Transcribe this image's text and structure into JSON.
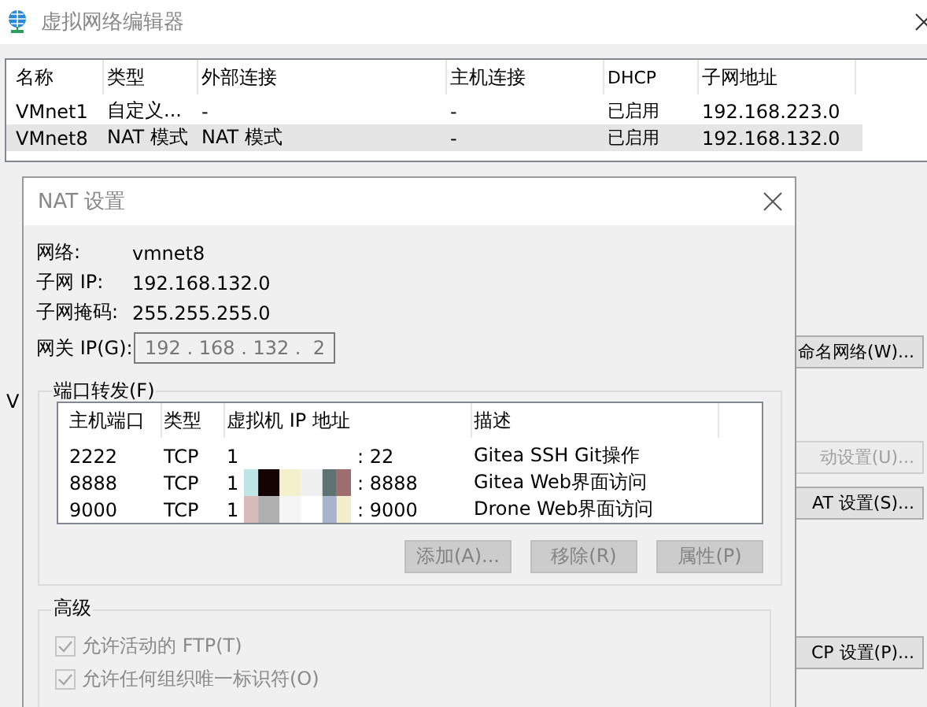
{
  "window": {
    "title": "虚拟网络编辑器"
  },
  "networks": {
    "columns": [
      "名称",
      "类型",
      "外部连接",
      "主机连接",
      "DHCP",
      "子网地址"
    ],
    "rows": [
      {
        "cells": [
          "VMnet1",
          "自定义...",
          "-",
          "-",
          "已启用",
          "192.168.223.0"
        ],
        "selected": false
      },
      {
        "cells": [
          "VMnet8",
          "NAT 模式",
          "NAT 模式",
          "-",
          "已启用",
          "192.168.132.0"
        ],
        "selected": true
      }
    ]
  },
  "side_label": "V",
  "side_buttons": [
    "命名网络(W)...",
    "动设置(U)...",
    "AT 设置(S)...",
    "CP 设置(P)..."
  ],
  "dialog": {
    "title": "NAT 设置",
    "info": [
      {
        "label": "网络:",
        "value": "vmnet8"
      },
      {
        "label": "子网 IP:",
        "value": "192.168.132.0"
      },
      {
        "label": "子网掩码:",
        "value": "255.255.255.0"
      }
    ],
    "gateway": {
      "label": "网关 IP(G):",
      "value": "192 . 168 . 132 .  2"
    },
    "port_forwarding": {
      "title": "端口转发(F)",
      "columns": [
        "主机端口",
        "类型",
        "虚拟机 IP 地址",
        "描述"
      ],
      "rows": [
        {
          "port": "2222",
          "type": "TCP",
          "ip_start": "1",
          "ip_port": ": 22",
          "description": "Gitea SSH Git操作"
        },
        {
          "port": "8888",
          "type": "TCP",
          "ip_start": "1",
          "ip_port": ": 8888",
          "description": "Gitea Web界面访问"
        },
        {
          "port": "9000",
          "type": "TCP",
          "ip_start": "1",
          "ip_port": ": 9000",
          "description": "Drone Web界面访问"
        }
      ],
      "buttons": [
        {
          "label": "添加(A)...",
          "disabled": true
        },
        {
          "label": "移除(R)",
          "disabled": true
        },
        {
          "label": "属性(P)",
          "disabled": true
        }
      ]
    },
    "advanced": {
      "title": "高级",
      "options": [
        {
          "label": "允许活动的 FTP(T)",
          "checked": true,
          "disabled": true
        },
        {
          "label": "允许任何组织唯一标识符(O)",
          "checked": true,
          "disabled": true
        }
      ]
    }
  }
}
